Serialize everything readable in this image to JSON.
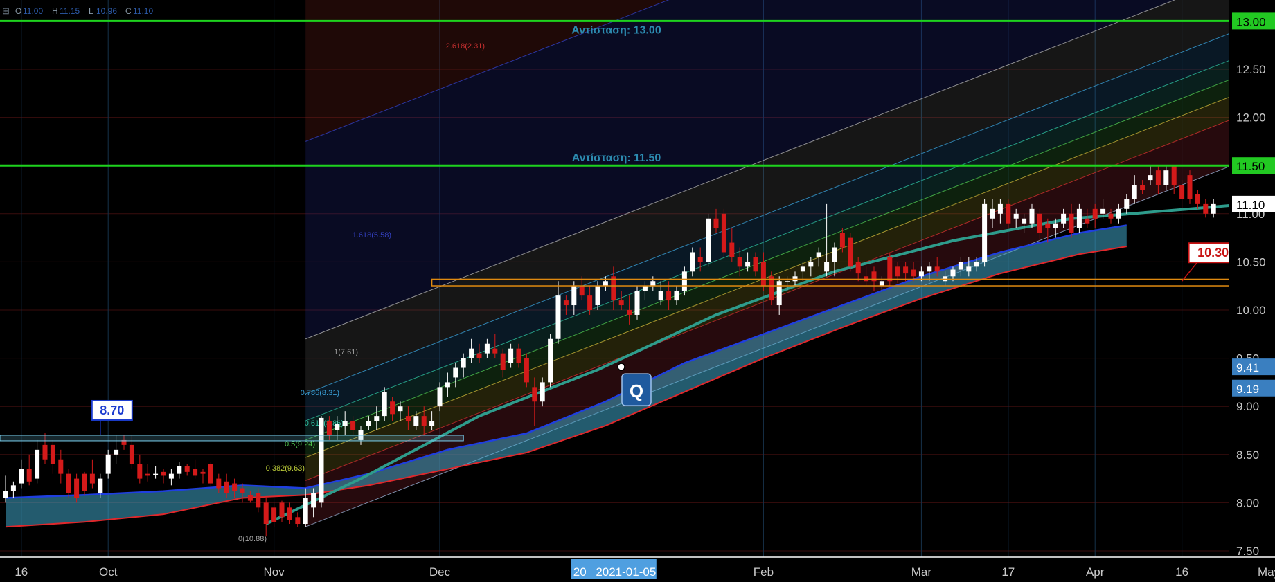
{
  "chart_data": {
    "type": "candlestick",
    "ohlc_header": [
      {
        "label": "O",
        "value": "11.00"
      },
      {
        "label": "H",
        "value": "11.15"
      },
      {
        "label": "L",
        "value": "10.96"
      },
      {
        "label": "C",
        "value": "11.10"
      }
    ],
    "y_ticks": [
      "7.50",
      "8.00",
      "8.50",
      "9.00",
      "9.50",
      "10.00",
      "10.50",
      "11.00",
      "11.50",
      "12.00",
      "12.50",
      "13.00"
    ],
    "y_tick_values": [
      7.5,
      8.0,
      8.5,
      9.0,
      9.5,
      10.0,
      10.5,
      11.0,
      11.5,
      12.0,
      12.5,
      13.0
    ],
    "ylim": [
      7.5,
      13.25
    ],
    "x_ticks": [
      {
        "label": "16",
        "bar": 2
      },
      {
        "label": "Oct",
        "bar": 13
      },
      {
        "label": "Nov",
        "bar": 34
      },
      {
        "label": "Dec",
        "bar": 55
      },
      {
        "label": "Feb",
        "bar": 96
      },
      {
        "label": "Mar",
        "bar": 116
      },
      {
        "label": "17",
        "bar": 127
      },
      {
        "label": "Apr",
        "bar": 138
      },
      {
        "label": "16",
        "bar": 149
      },
      {
        "label": "May",
        "bar": 160
      }
    ],
    "x_cursor_label": "2021-01-05",
    "x_cursor_bar": 77,
    "x_cursor_prefix": "20",
    "bars": 163,
    "candles": [
      [
        8.05,
        8.28,
        8.0,
        8.12
      ],
      [
        8.12,
        8.22,
        8.05,
        8.18
      ],
      [
        8.2,
        8.45,
        8.15,
        8.35
      ],
      [
        8.35,
        8.5,
        8.18,
        8.22
      ],
      [
        8.25,
        8.65,
        8.2,
        8.55
      ],
      [
        8.6,
        8.72,
        8.4,
        8.45
      ],
      [
        8.6,
        8.65,
        8.3,
        8.4
      ],
      [
        8.45,
        8.55,
        8.2,
        8.3
      ],
      [
        8.3,
        8.35,
        8.05,
        8.1
      ],
      [
        8.25,
        8.3,
        8.0,
        8.05
      ],
      [
        8.3,
        8.32,
        8.08,
        8.12
      ],
      [
        8.3,
        8.45,
        8.15,
        8.2
      ],
      [
        8.1,
        8.3,
        8.05,
        8.25
      ],
      [
        8.3,
        8.55,
        8.25,
        8.5
      ],
      [
        8.5,
        8.7,
        8.4,
        8.55
      ],
      [
        8.65,
        8.7,
        8.55,
        8.6
      ],
      [
        8.6,
        8.7,
        8.35,
        8.4
      ],
      [
        8.4,
        8.5,
        8.2,
        8.25
      ],
      [
        8.3,
        8.4,
        8.22,
        8.28
      ],
      [
        8.3,
        8.38,
        8.25,
        8.3
      ],
      [
        8.32,
        8.35,
        8.2,
        8.28
      ],
      [
        8.25,
        8.35,
        8.18,
        8.3
      ],
      [
        8.3,
        8.42,
        8.25,
        8.38
      ],
      [
        8.38,
        8.4,
        8.28,
        8.32
      ],
      [
        8.35,
        8.45,
        8.25,
        8.28
      ],
      [
        8.32,
        8.35,
        8.2,
        8.3
      ],
      [
        8.4,
        8.42,
        8.15,
        8.2
      ],
      [
        8.25,
        8.3,
        8.1,
        8.15
      ],
      [
        8.22,
        8.3,
        8.05,
        8.1
      ],
      [
        8.2,
        8.25,
        8.05,
        8.12
      ],
      [
        8.15,
        8.2,
        8.0,
        8.1
      ],
      [
        8.08,
        8.12,
        8.0,
        8.02
      ],
      [
        8.1,
        8.15,
        7.9,
        7.95
      ],
      [
        8.0,
        8.05,
        7.65,
        7.78
      ],
      [
        7.95,
        8.0,
        7.75,
        7.8
      ],
      [
        8.0,
        8.02,
        7.8,
        7.85
      ],
      [
        7.95,
        8.0,
        7.78,
        7.82
      ],
      [
        7.85,
        7.9,
        7.75,
        7.78
      ],
      [
        7.78,
        8.15,
        7.75,
        8.05
      ],
      [
        7.95,
        8.15,
        7.85,
        8.1
      ],
      [
        8.0,
        8.9,
        7.95,
        8.88
      ],
      [
        8.85,
        8.9,
        8.65,
        8.7
      ],
      [
        8.75,
        8.9,
        8.65,
        8.82
      ],
      [
        8.8,
        8.95,
        8.7,
        8.85
      ],
      [
        8.85,
        8.9,
        8.7,
        8.75
      ],
      [
        8.65,
        8.8,
        8.6,
        8.75
      ],
      [
        8.8,
        8.9,
        8.75,
        8.85
      ],
      [
        8.85,
        9.0,
        8.75,
        8.9
      ],
      [
        8.9,
        9.2,
        8.85,
        9.15
      ],
      [
        9.05,
        9.1,
        8.85,
        8.92
      ],
      [
        8.95,
        9.05,
        8.85,
        9.0
      ],
      [
        8.9,
        9.0,
        8.75,
        8.85
      ],
      [
        8.8,
        8.95,
        8.75,
        8.9
      ],
      [
        8.9,
        9.0,
        8.7,
        8.8
      ],
      [
        8.8,
        8.95,
        8.75,
        8.85
      ],
      [
        9.0,
        9.25,
        8.95,
        9.2
      ],
      [
        9.2,
        9.35,
        9.1,
        9.25
      ],
      [
        9.3,
        9.45,
        9.2,
        9.4
      ],
      [
        9.4,
        9.55,
        9.3,
        9.5
      ],
      [
        9.5,
        9.7,
        9.45,
        9.6
      ],
      [
        9.55,
        9.65,
        9.45,
        9.5
      ],
      [
        9.55,
        9.7,
        9.5,
        9.65
      ],
      [
        9.6,
        9.75,
        9.5,
        9.55
      ],
      [
        9.55,
        9.6,
        9.3,
        9.38
      ],
      [
        9.45,
        9.65,
        9.4,
        9.6
      ],
      [
        9.6,
        9.65,
        9.4,
        9.45
      ],
      [
        9.5,
        9.55,
        9.2,
        9.25
      ],
      [
        9.2,
        9.3,
        8.8,
        9.05
      ],
      [
        9.05,
        9.3,
        9.0,
        9.25
      ],
      [
        9.25,
        9.75,
        9.2,
        9.7
      ],
      [
        9.7,
        10.3,
        9.65,
        10.15
      ],
      [
        10.1,
        10.15,
        9.95,
        10.05
      ],
      [
        10.05,
        10.3,
        9.95,
        10.25
      ],
      [
        10.25,
        10.35,
        10.1,
        10.15
      ],
      [
        10.15,
        10.25,
        9.95,
        10.0
      ],
      [
        10.05,
        10.3,
        10.0,
        10.25
      ],
      [
        10.25,
        10.35,
        10.2,
        10.3
      ],
      [
        10.35,
        10.45,
        10.0,
        10.1
      ],
      [
        10.1,
        10.2,
        10.0,
        10.05
      ],
      [
        10.0,
        10.15,
        9.85,
        9.95
      ],
      [
        9.95,
        10.25,
        9.9,
        10.2
      ],
      [
        10.2,
        10.3,
        10.1,
        10.25
      ],
      [
        10.25,
        10.35,
        10.2,
        10.3
      ],
      [
        10.1,
        10.3,
        10.05,
        10.2
      ],
      [
        10.2,
        10.3,
        10.0,
        10.1
      ],
      [
        10.1,
        10.25,
        10.05,
        10.2
      ],
      [
        10.2,
        10.45,
        10.15,
        10.4
      ],
      [
        10.4,
        10.65,
        10.35,
        10.6
      ],
      [
        10.55,
        10.65,
        10.4,
        10.5
      ],
      [
        10.5,
        11.0,
        10.45,
        10.95
      ],
      [
        10.95,
        11.05,
        10.8,
        10.85
      ],
      [
        11.0,
        11.05,
        10.55,
        10.6
      ],
      [
        10.7,
        10.85,
        10.5,
        10.55
      ],
      [
        10.55,
        10.65,
        10.35,
        10.45
      ],
      [
        10.45,
        10.6,
        10.4,
        10.5
      ],
      [
        10.55,
        10.6,
        10.35,
        10.4
      ],
      [
        10.5,
        10.6,
        10.2,
        10.25
      ],
      [
        10.35,
        10.4,
        10.05,
        10.1
      ],
      [
        10.05,
        10.35,
        9.95,
        10.3
      ],
      [
        10.3,
        10.35,
        10.2,
        10.3
      ],
      [
        10.3,
        10.4,
        10.25,
        10.35
      ],
      [
        10.4,
        10.5,
        10.3,
        10.45
      ],
      [
        10.45,
        10.55,
        10.35,
        10.5
      ],
      [
        10.55,
        10.65,
        10.45,
        10.6
      ],
      [
        10.4,
        11.1,
        10.35,
        10.5
      ],
      [
        10.5,
        10.7,
        10.35,
        10.65
      ],
      [
        10.8,
        10.85,
        10.6,
        10.65
      ],
      [
        10.75,
        10.8,
        10.4,
        10.45
      ],
      [
        10.5,
        10.55,
        10.3,
        10.38
      ],
      [
        10.35,
        10.45,
        10.25,
        10.3
      ],
      [
        10.4,
        10.45,
        10.2,
        10.3
      ],
      [
        10.25,
        10.35,
        10.2,
        10.3
      ],
      [
        10.55,
        10.6,
        10.25,
        10.3
      ],
      [
        10.45,
        10.5,
        10.28,
        10.35
      ],
      [
        10.45,
        10.5,
        10.3,
        10.38
      ],
      [
        10.42,
        10.5,
        10.3,
        10.35
      ],
      [
        10.35,
        10.45,
        10.3,
        10.4
      ],
      [
        10.4,
        10.5,
        10.3,
        10.45
      ],
      [
        10.45,
        10.55,
        10.35,
        10.4
      ],
      [
        10.3,
        10.4,
        10.25,
        10.35
      ],
      [
        10.35,
        10.45,
        10.3,
        10.42
      ],
      [
        10.42,
        10.55,
        10.35,
        10.5
      ],
      [
        10.4,
        10.55,
        10.35,
        10.45
      ],
      [
        10.45,
        10.55,
        10.4,
        10.5
      ],
      [
        10.5,
        11.15,
        10.45,
        11.1
      ],
      [
        10.95,
        11.15,
        10.85,
        11.05
      ],
      [
        11.0,
        11.15,
        10.9,
        11.1
      ],
      [
        11.1,
        11.15,
        10.85,
        10.9
      ],
      [
        10.95,
        11.05,
        10.85,
        11.0
      ],
      [
        10.9,
        11.0,
        10.8,
        10.95
      ],
      [
        10.9,
        11.1,
        10.85,
        11.05
      ],
      [
        11.0,
        11.05,
        10.7,
        10.8
      ],
      [
        10.9,
        10.95,
        10.7,
        10.85
      ],
      [
        10.85,
        10.95,
        10.75,
        10.9
      ],
      [
        10.9,
        11.05,
        10.85,
        11.0
      ],
      [
        11.0,
        11.1,
        10.75,
        10.8
      ],
      [
        10.85,
        11.1,
        10.8,
        11.05
      ],
      [
        10.95,
        11.05,
        10.85,
        10.9
      ],
      [
        11.05,
        11.1,
        10.85,
        10.95
      ],
      [
        11.0,
        11.15,
        10.95,
        11.05
      ],
      [
        11.0,
        11.05,
        10.9,
        10.95
      ],
      [
        10.95,
        11.1,
        10.9,
        11.05
      ],
      [
        11.05,
        11.2,
        11.0,
        11.15
      ],
      [
        11.15,
        11.4,
        11.1,
        11.3
      ],
      [
        11.3,
        11.35,
        11.2,
        11.25
      ],
      [
        11.35,
        11.5,
        11.3,
        11.4
      ],
      [
        11.45,
        11.5,
        11.2,
        11.3
      ],
      [
        11.3,
        11.5,
        11.25,
        11.45
      ],
      [
        11.5,
        11.5,
        11.2,
        11.3
      ],
      [
        11.3,
        11.35,
        11.05,
        11.15
      ],
      [
        11.4,
        11.45,
        11.1,
        11.15
      ],
      [
        11.2,
        11.25,
        11.05,
        11.1
      ],
      [
        11.1,
        11.15,
        10.96,
        11.0
      ],
      [
        11.0,
        11.15,
        10.96,
        11.1
      ]
    ],
    "horizontal_levels": [
      {
        "value": 13.0,
        "label": "Αντίσταση: 13.00",
        "color": "#1ed31e"
      },
      {
        "value": 11.5,
        "label": "Αντίσταση: 11.50",
        "color": "#1ed31e"
      }
    ],
    "price_tags": [
      {
        "text": "13.00",
        "value": 13.0,
        "bg": "#22c922",
        "fg": "#000000"
      },
      {
        "text": "11.50",
        "value": 11.5,
        "bg": "#22c922",
        "fg": "#000000"
      },
      {
        "text": "11.10",
        "value": 11.1,
        "bg": "#ffffff",
        "fg": "#000000"
      },
      {
        "text": "9.41",
        "value": 9.41,
        "bg": "#3a7fc0",
        "fg": "#ffffff"
      },
      {
        "text": "9.19",
        "value": 9.19,
        "bg": "#3a7fc0",
        "fg": "#ffffff"
      }
    ],
    "callouts": [
      {
        "text": "8.70",
        "value": 8.7,
        "bar": 12,
        "border": "#1c3ccf",
        "fg": "#1c3ccf"
      },
      {
        "text": "10.30",
        "value": 10.3,
        "bar": 149,
        "border": "#c81414",
        "fg": "#c81414"
      }
    ],
    "q_marker": {
      "text": "Q",
      "bar": 80,
      "value": 9.41
    },
    "fib_labels": [
      {
        "text": "2.618(2.31)",
        "color": "#c83030"
      },
      {
        "text": "1.618(5.58)",
        "color": "#3340c0"
      },
      {
        "text": "1(7.61)",
        "color": "#9a9a9a"
      },
      {
        "text": "0.786(8.31)",
        "color": "#3aa0d8"
      },
      {
        "text": "0.618(8.86)",
        "color": "#2ec0a0"
      },
      {
        "text": "0.5(9.24)",
        "color": "#50c850"
      },
      {
        "text": "0.382(9.63)",
        "color": "#b8c838"
      },
      {
        "text": "0(10.88)",
        "color": "#a8a8a8"
      }
    ],
    "colors": {
      "bull": "#ffffff",
      "bear": "#d41a1a",
      "level": "#1ed31e",
      "ma_blue": "#1f3fe0",
      "ma_red": "#e0282c",
      "band_fill": "#3fa6c8",
      "curve": "#2e9c8c",
      "support_box": "#e08a10",
      "grid_v": "#16324a",
      "grid_h": "#3a0d0d"
    }
  }
}
